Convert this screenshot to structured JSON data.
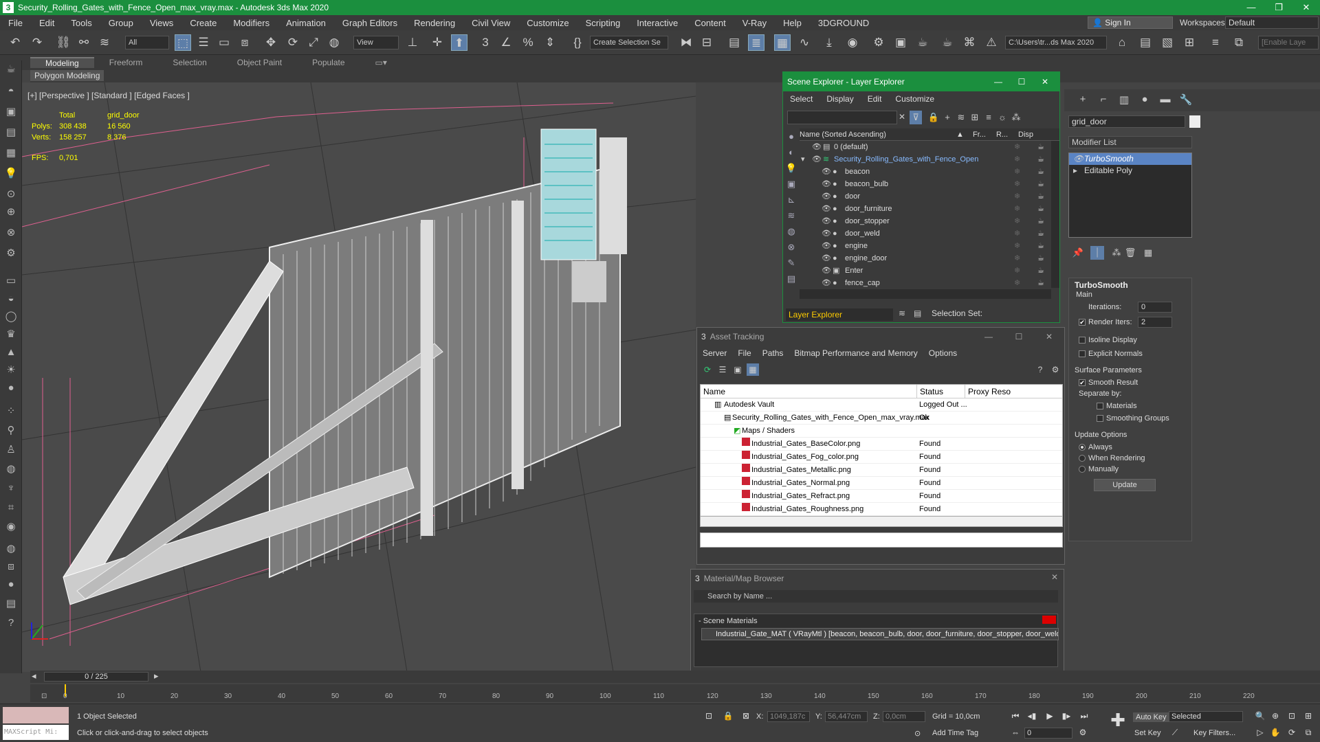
{
  "window": {
    "title": "Security_Rolling_Gates_with_Fence_Open_max_vray.max - Autodesk 3ds Max 2020",
    "app_icon": "3",
    "min": "—",
    "max": "❐",
    "close": "✕"
  },
  "menu": [
    "File",
    "Edit",
    "Tools",
    "Group",
    "Views",
    "Create",
    "Modifiers",
    "Animation",
    "Graph Editors",
    "Rendering",
    "Civil View",
    "Customize",
    "Scripting",
    "Interactive",
    "Content",
    "V-Ray",
    "Help",
    "3DGROUND"
  ],
  "account": {
    "signin": "Sign In",
    "workspaces_label": "Workspaces:",
    "workspace": "Default"
  },
  "toolbar": {
    "selection_filter": "All",
    "ref_coord": "View",
    "named_selection": "Create Selection Se",
    "path": "C:\\Users\\tr...ds Max 2020",
    "enable_layers": "[Enable Laye"
  },
  "ribbon": {
    "tabs": [
      "Modeling",
      "Freeform",
      "Selection",
      "Object Paint",
      "Populate"
    ],
    "active": "Modeling",
    "sub": "Polygon Modeling"
  },
  "viewport": {
    "label": "[+] [Perspective ] [Standard ] [Edged Faces ]",
    "stats": {
      "col_total": "Total",
      "col_obj": "grid_door",
      "polys_label": "Polys:",
      "polys_total": "308 438",
      "polys_obj": "16 560",
      "verts_label": "Verts:",
      "verts_total": "158 257",
      "verts_obj": "8 376",
      "fps_label": "FPS:",
      "fps": "0,701"
    }
  },
  "scene_explorer": {
    "title": "Scene Explorer - Layer Explorer",
    "menu": [
      "Select",
      "Display",
      "Edit",
      "Customize"
    ],
    "columns": {
      "name": "Name (Sorted Ascending)",
      "frozen": "Fr...",
      "render": "R...",
      "display": "Disp"
    },
    "rows": [
      {
        "name": "0 (default)",
        "level": 0
      },
      {
        "name": "Security_Rolling_Gates_with_Fence_Open",
        "level": 0
      },
      {
        "name": "beacon",
        "level": 1
      },
      {
        "name": "beacon_bulb",
        "level": 1
      },
      {
        "name": "door",
        "level": 1
      },
      {
        "name": "door_furniture",
        "level": 1
      },
      {
        "name": "door_stopper",
        "level": 1
      },
      {
        "name": "door_weld",
        "level": 1
      },
      {
        "name": "engine",
        "level": 1
      },
      {
        "name": "engine_door",
        "level": 1
      },
      {
        "name": "Enter",
        "level": 1
      },
      {
        "name": "fence_cap",
        "level": 1
      }
    ],
    "footer_dropdown": "Layer Explorer",
    "selection_set_label": "Selection Set:"
  },
  "asset_tracking": {
    "title": "Asset Tracking",
    "menu": [
      "Server",
      "File",
      "Paths",
      "Bitmap Performance and Memory",
      "Options"
    ],
    "columns": {
      "name": "Name",
      "status": "Status",
      "proxy": "Proxy Reso"
    },
    "rows": [
      {
        "name": "Autodesk Vault",
        "status": "Logged Out ...",
        "indent": 1
      },
      {
        "name": "Security_Rolling_Gates_with_Fence_Open_max_vray.max",
        "status": "Ok",
        "indent": 2
      },
      {
        "name": "Maps / Shaders",
        "status": "",
        "indent": 3
      },
      {
        "name": "Industrial_Gates_BaseColor.png",
        "status": "Found",
        "indent": 4
      },
      {
        "name": "Industrial_Gates_Fog_color.png",
        "status": "Found",
        "indent": 4
      },
      {
        "name": "Industrial_Gates_Metallic.png",
        "status": "Found",
        "indent": 4
      },
      {
        "name": "Industrial_Gates_Normal.png",
        "status": "Found",
        "indent": 4
      },
      {
        "name": "Industrial_Gates_Refract.png",
        "status": "Found",
        "indent": 4
      },
      {
        "name": "Industrial_Gates_Roughness.png",
        "status": "Found",
        "indent": 4
      }
    ]
  },
  "material_browser": {
    "title": "Material/Map Browser",
    "search_placeholder": "Search by Name ...",
    "group": "- Scene Materials",
    "item": "Industrial_Gate_MAT ( VRayMtl ) [beacon, beacon_bulb, door, door_furniture, door_stopper, door_weld, engine, engine_door, fence_cap, fence_weld, gate,..."
  },
  "command_panel": {
    "object_name": "grid_door",
    "modifier_list": "Modifier List",
    "stack": [
      "TurboSmooth",
      "Editable Poly"
    ],
    "turbosmooth": {
      "title": "TurboSmooth",
      "main": "Main",
      "iterations_label": "Iterations:",
      "iterations": "0",
      "render_iters_label": "Render Iters:",
      "render_iters": "2",
      "isoline": "Isoline Display",
      "explicit": "Explicit Normals",
      "surface": "Surface Parameters",
      "smooth_result": "Smooth Result",
      "separate_by": "Separate by:",
      "materials": "Materials",
      "smoothing_groups": "Smoothing Groups",
      "update_options": "Update Options",
      "always": "Always",
      "when_rendering": "When Rendering",
      "manually": "Manually",
      "update_btn": "Update"
    }
  },
  "timeline": {
    "frame": "0 / 225",
    "ticks": [
      "0",
      "10",
      "20",
      "30",
      "40",
      "50",
      "60",
      "70",
      "80",
      "90",
      "100",
      "110",
      "120",
      "130",
      "140",
      "150",
      "160",
      "170",
      "180",
      "190",
      "200",
      "210",
      "220"
    ]
  },
  "status": {
    "maxscript": "MAXScript Mi:",
    "selected": "1 Object Selected",
    "prompt": "Click or click-and-drag to select objects",
    "x_label": "X:",
    "x": "1049,187c",
    "y_label": "Y:",
    "y": "56,447cm",
    "z_label": "Z:",
    "z": "0,0cm",
    "grid": "Grid = 10,0cm",
    "add_time_tag": "Add Time Tag",
    "auto_key": "Auto Key",
    "set_key": "Set Key",
    "selected_dropdown": "Selected",
    "key_filters": "Key Filters...",
    "frame_field": "0"
  }
}
